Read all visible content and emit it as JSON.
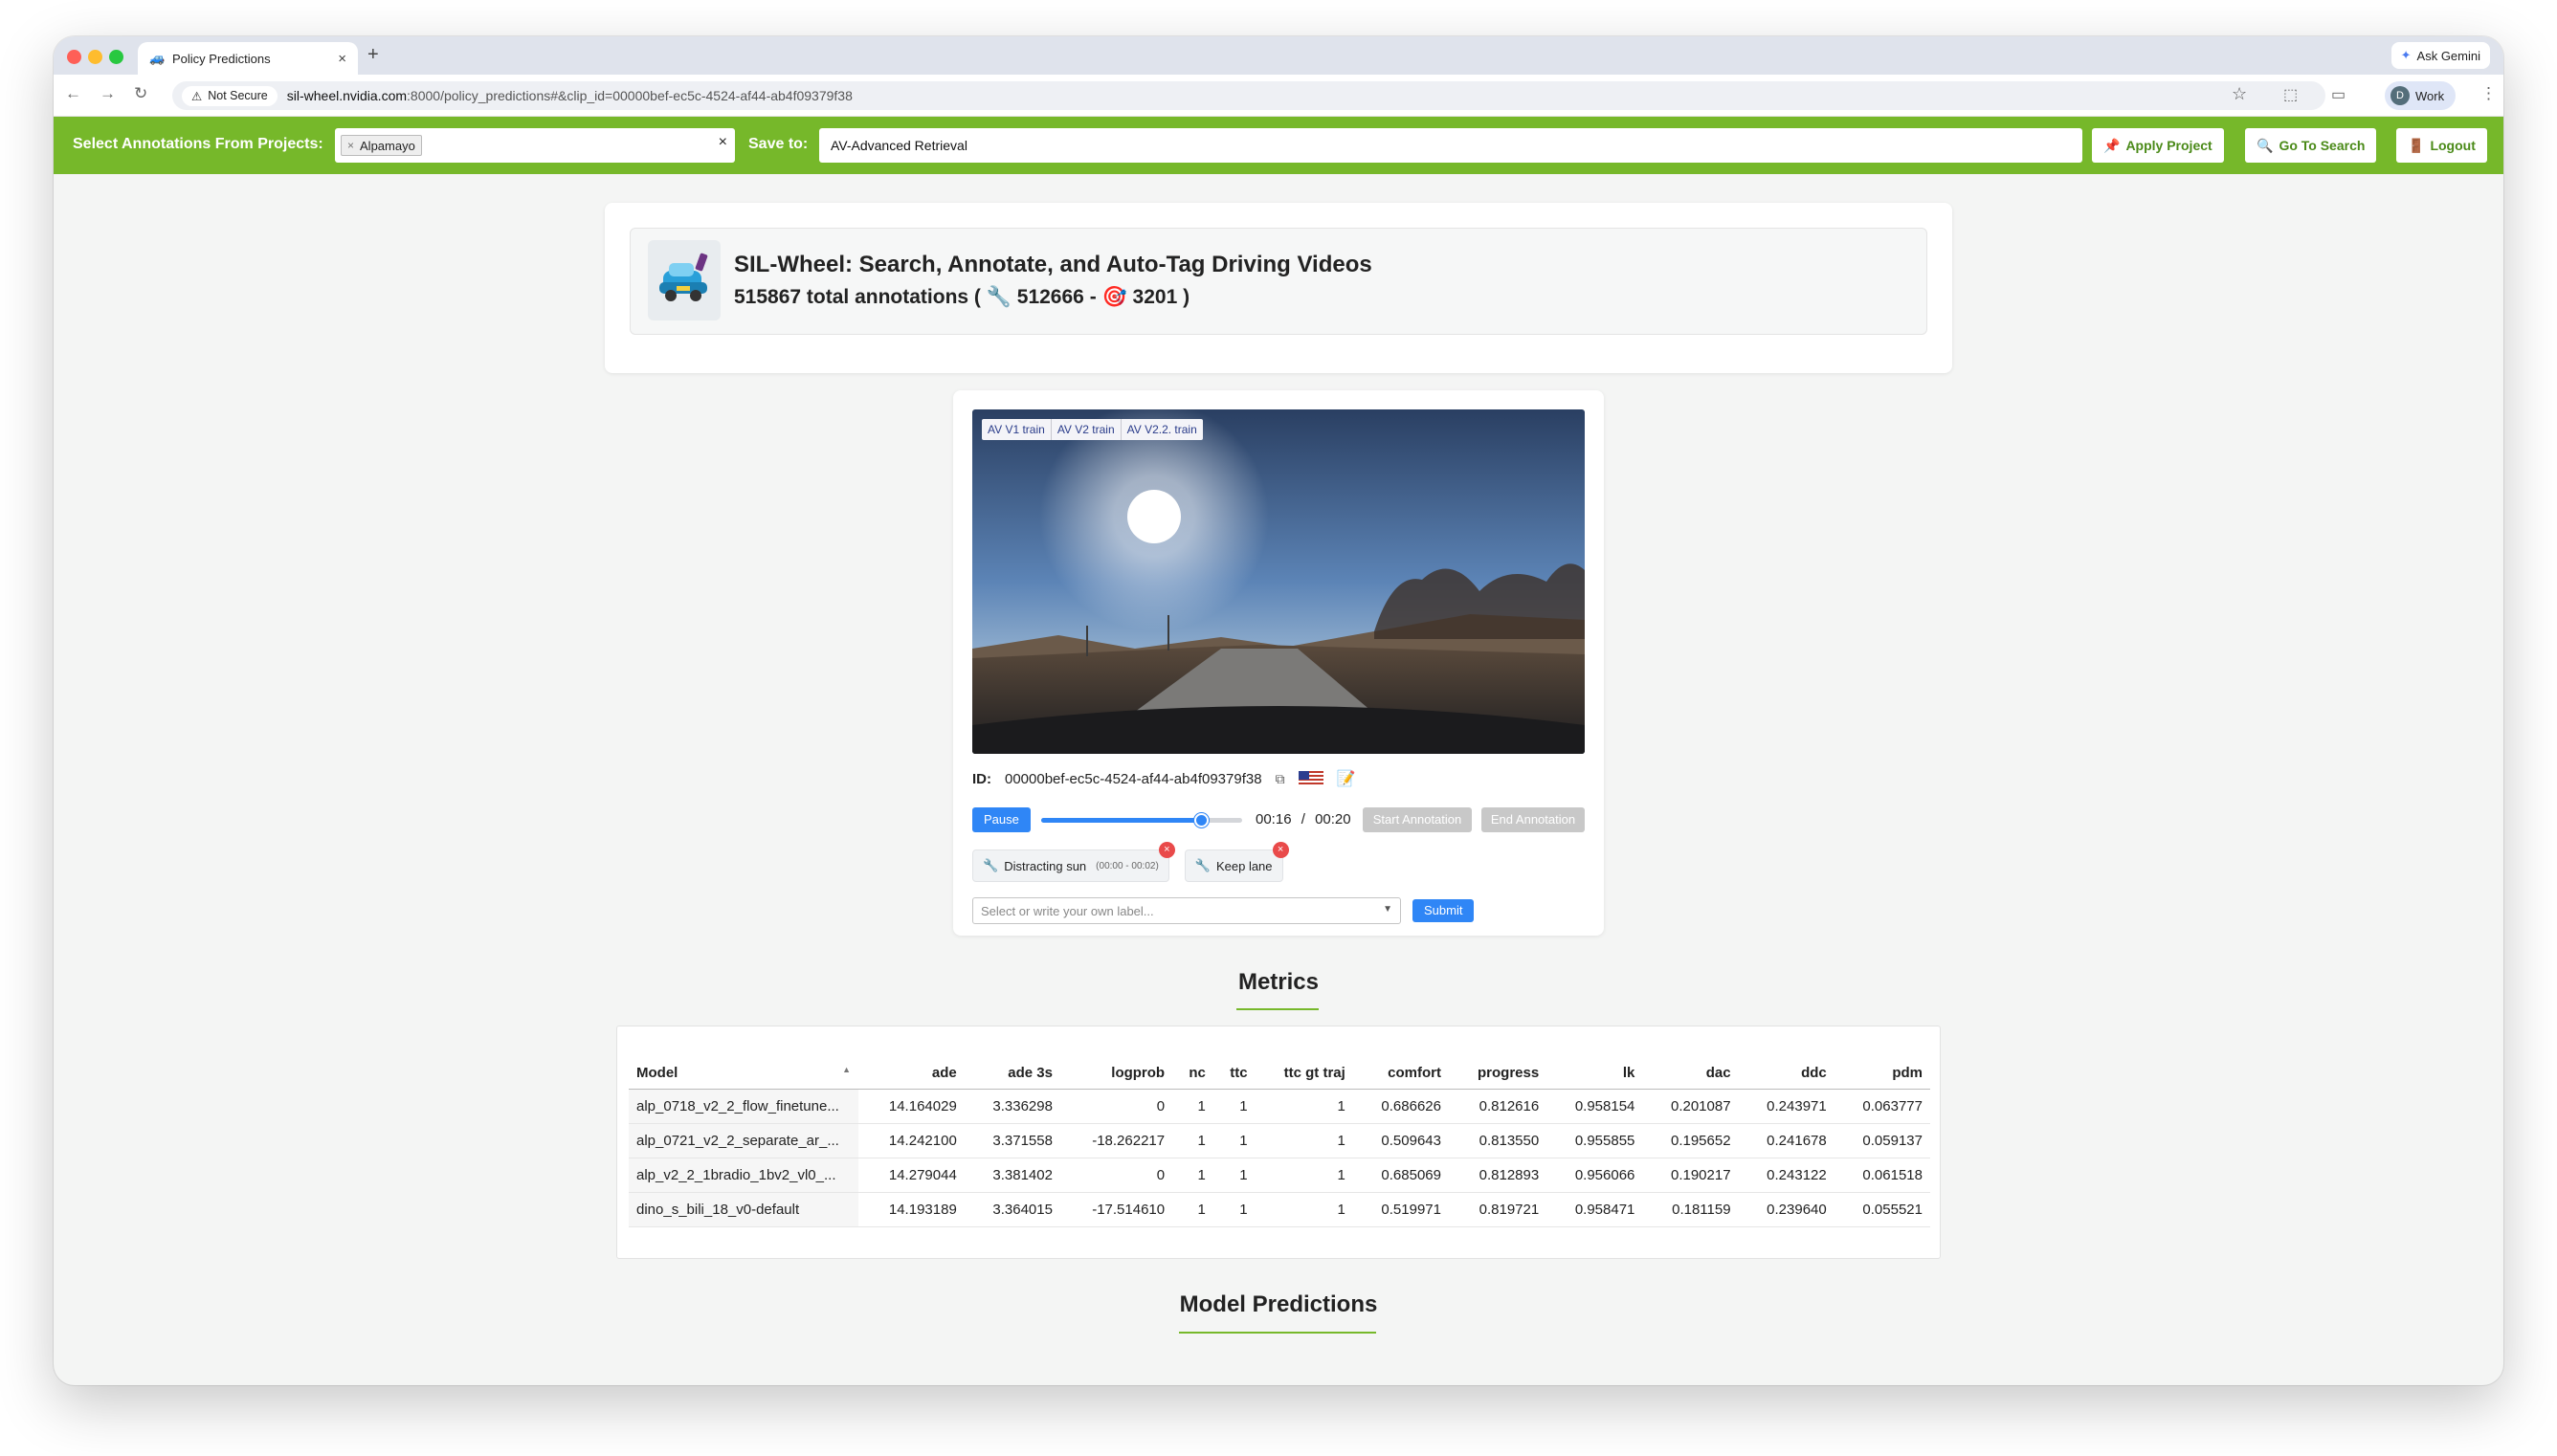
{
  "browser": {
    "tab_title": "Policy Predictions",
    "new_tab": "+",
    "gemini_label": "Ask Gemini",
    "not_secure": "Not Secure",
    "url_host": "sil-wheel.nvidia.com",
    "url_path": ":8000/policy_predictions#&clip_id=00000bef-ec5c-4524-af44-ab4f09379f38",
    "profile_initial": "D",
    "profile_label": "Work"
  },
  "topbar": {
    "select_label": "Select Annotations From Projects:",
    "selected_project": "Alpamayo",
    "save_to_label": "Save to:",
    "save_to_value": "AV-Advanced Retrieval",
    "apply_button": "Apply Project",
    "search_button": "Go To Search",
    "logout_button": "Logout",
    "accent_color": "#76b82a"
  },
  "header": {
    "title": "SIL-Wheel: Search, Annotate, and Auto-Tag Driving Videos",
    "total_count": "515867",
    "total_text": "total annotations (",
    "wrench_count": "512666",
    "dash": "-",
    "target_count": "3201",
    "close_paren": ")"
  },
  "video": {
    "tags": [
      "AV V1 train",
      "AV V2 train",
      "AV V2.2. train"
    ],
    "id_label": "ID:",
    "clip_id": "00000bef-ec5c-4524-af44-ab4f09379f38",
    "pause_button": "Pause",
    "progress": 0.8,
    "current_time": "00:16",
    "time_sep": "/",
    "duration": "00:20",
    "start_annotation": "Start Annotation",
    "end_annotation": "End Annotation",
    "labels": [
      {
        "text": "Distracting sun",
        "time": "(00:00 - 00:02)"
      },
      {
        "text": "Keep lane",
        "time": ""
      }
    ],
    "label_placeholder": "Select or write your own label...",
    "submit_button": "Submit"
  },
  "metrics": {
    "heading": "Metrics",
    "columns": [
      "Model",
      "ade",
      "ade 3s",
      "logprob",
      "nc",
      "ttc",
      "ttc gt traj",
      "comfort",
      "progress",
      "lk",
      "dac",
      "ddc",
      "pdm"
    ],
    "rows": [
      [
        "alp_0718_v2_2_flow_finetune...",
        "14.164029",
        "3.336298",
        "0",
        "1",
        "1",
        "1",
        "0.686626",
        "0.812616",
        "0.958154",
        "0.201087",
        "0.243971",
        "0.063777"
      ],
      [
        "alp_0721_v2_2_separate_ar_...",
        "14.242100",
        "3.371558",
        "-18.262217",
        "1",
        "1",
        "1",
        "0.509643",
        "0.813550",
        "0.955855",
        "0.195652",
        "0.241678",
        "0.059137"
      ],
      [
        "alp_v2_2_1bradio_1bv2_vl0_...",
        "14.279044",
        "3.381402",
        "0",
        "1",
        "1",
        "1",
        "0.685069",
        "0.812893",
        "0.956066",
        "0.190217",
        "0.243122",
        "0.061518"
      ],
      [
        "dino_s_bili_18_v0-default",
        "14.193189",
        "3.364015",
        "-17.514610",
        "1",
        "1",
        "1",
        "0.519971",
        "0.819721",
        "0.958471",
        "0.181159",
        "0.239640",
        "0.055521"
      ]
    ]
  },
  "predictions": {
    "heading": "Model Predictions"
  }
}
